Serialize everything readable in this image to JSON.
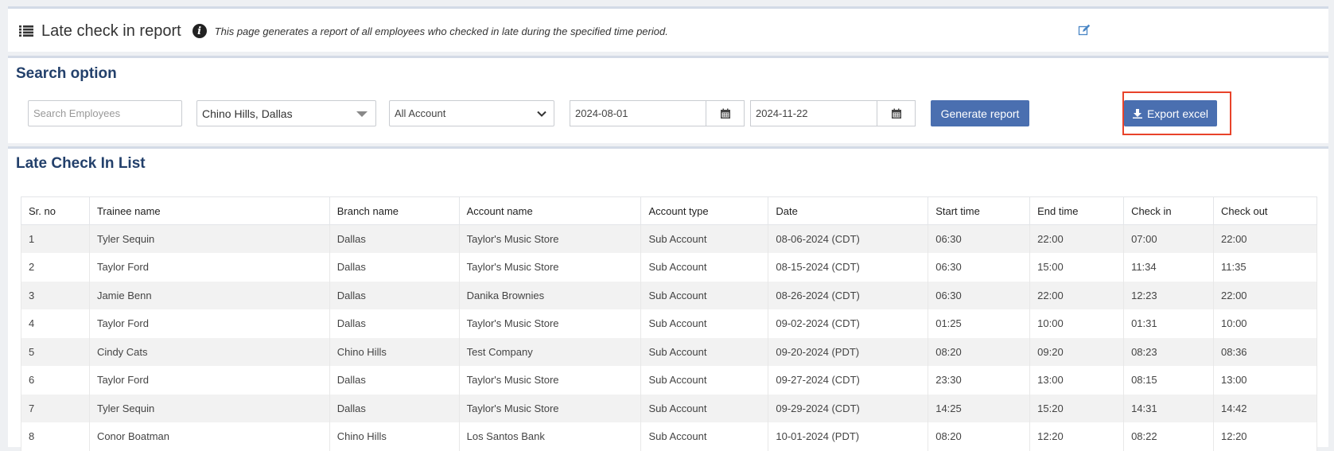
{
  "header": {
    "title": "Late check in report",
    "description": "This page generates a report of all employees who checked in late during the specified time period."
  },
  "search": {
    "title": "Search option",
    "employee_placeholder": "Search Employees",
    "branch_value": "Chino Hills, Dallas",
    "account_value": "All Account",
    "start_date": "2024-08-01",
    "end_date": "2024-11-22",
    "generate_label": "Generate report",
    "export_label": "Export excel"
  },
  "list": {
    "title": "Late Check In List",
    "columns": [
      "Sr. no",
      "Trainee name",
      "Branch name",
      "Account name",
      "Account type",
      "Date",
      "Start time",
      "End time",
      "Check in",
      "Check out"
    ],
    "rows": [
      [
        "1",
        "Tyler Sequin",
        "Dallas",
        "Taylor's Music Store",
        "Sub Account",
        "08-06-2024 (CDT)",
        "06:30",
        "22:00",
        "07:00",
        "22:00"
      ],
      [
        "2",
        "Taylor Ford",
        "Dallas",
        "Taylor's Music Store",
        "Sub Account",
        "08-15-2024 (CDT)",
        "06:30",
        "15:00",
        "11:34",
        "11:35"
      ],
      [
        "3",
        "Jamie Benn",
        "Dallas",
        "Danika Brownies",
        "Sub Account",
        "08-26-2024 (CDT)",
        "06:30",
        "22:00",
        "12:23",
        "22:00"
      ],
      [
        "4",
        "Taylor Ford",
        "Dallas",
        "Taylor's Music Store",
        "Sub Account",
        "09-02-2024 (CDT)",
        "01:25",
        "10:00",
        "01:31",
        "10:00"
      ],
      [
        "5",
        "Cindy Cats",
        "Chino Hills",
        "Test Company",
        "Sub Account",
        "09-20-2024 (PDT)",
        "08:20",
        "09:20",
        "08:23",
        "08:36"
      ],
      [
        "6",
        "Taylor Ford",
        "Dallas",
        "Taylor's Music Store",
        "Sub Account",
        "09-27-2024 (CDT)",
        "23:30",
        "13:00",
        "08:15",
        "13:00"
      ],
      [
        "7",
        "Tyler Sequin",
        "Dallas",
        "Taylor's Music Store",
        "Sub Account",
        "09-29-2024 (CDT)",
        "14:25",
        "15:20",
        "14:31",
        "14:42"
      ],
      [
        "8",
        "Conor Boatman",
        "Chino Hills",
        "Los Santos Bank",
        "Sub Account",
        "10-01-2024 (PDT)",
        "08:20",
        "12:20",
        "08:22",
        "12:20"
      ]
    ]
  },
  "colors": {
    "accent": "#4a6fb0",
    "title": "#23406b",
    "highlight": "#e8432a"
  }
}
